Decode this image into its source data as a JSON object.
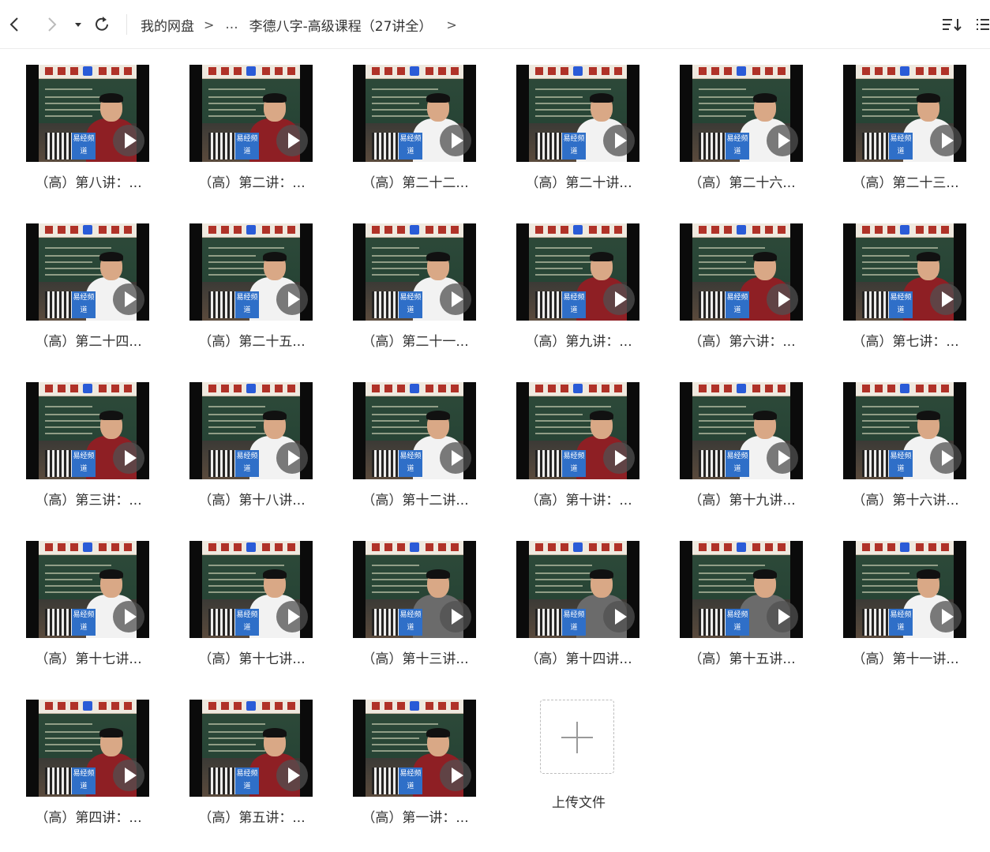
{
  "toolbar": {
    "back_icon": "chevron-left-icon",
    "forward_icon": "chevron-right-icon",
    "history_icon": "caret-down-icon",
    "refresh_icon": "refresh-icon",
    "sort_icon": "sort-icon",
    "view_icon": "list-view-icon"
  },
  "breadcrumb": {
    "root": "我的网盘",
    "separator": ">",
    "ellipsis": "...",
    "current": "李德八字-高级课程（27讲全）",
    "trailing_separator": ">"
  },
  "files": [
    {
      "label": "（高）第八讲：..."
    },
    {
      "label": "（高）第二讲：..."
    },
    {
      "label": "（高）第二十二..."
    },
    {
      "label": "（高）第二十讲..."
    },
    {
      "label": "（高）第二十六..."
    },
    {
      "label": "（高）第二十三..."
    },
    {
      "label": "（高）第二十四..."
    },
    {
      "label": "（高）第二十五..."
    },
    {
      "label": "（高）第二十一..."
    },
    {
      "label": "（高）第九讲：..."
    },
    {
      "label": "（高）第六讲：..."
    },
    {
      "label": "（高）第七讲：..."
    },
    {
      "label": "（高）第三讲：..."
    },
    {
      "label": "（高）第十八讲..."
    },
    {
      "label": "（高）第十二讲..."
    },
    {
      "label": "（高）第十讲：..."
    },
    {
      "label": "（高）第十九讲..."
    },
    {
      "label": "（高）第十六讲..."
    },
    {
      "label": "（高）第十七讲..."
    },
    {
      "label": "（高）第十七讲..."
    },
    {
      "label": "（高）第十三讲..."
    },
    {
      "label": "（高）第十四讲..."
    },
    {
      "label": "（高）第十五讲..."
    },
    {
      "label": "（高）第十一讲..."
    },
    {
      "label": "（高）第四讲：..."
    },
    {
      "label": "（高）第五讲：..."
    },
    {
      "label": "（高）第一讲：..."
    }
  ],
  "upload": {
    "label": "上传文件",
    "icon": "plus-icon"
  },
  "thumb_logo": "易经频道",
  "colors": {
    "accent": "#2f6fc8",
    "jacket_red": "#8e1f24",
    "shirt_white": "#f2f2f2",
    "shirt_gray": "#6b6b6b"
  }
}
